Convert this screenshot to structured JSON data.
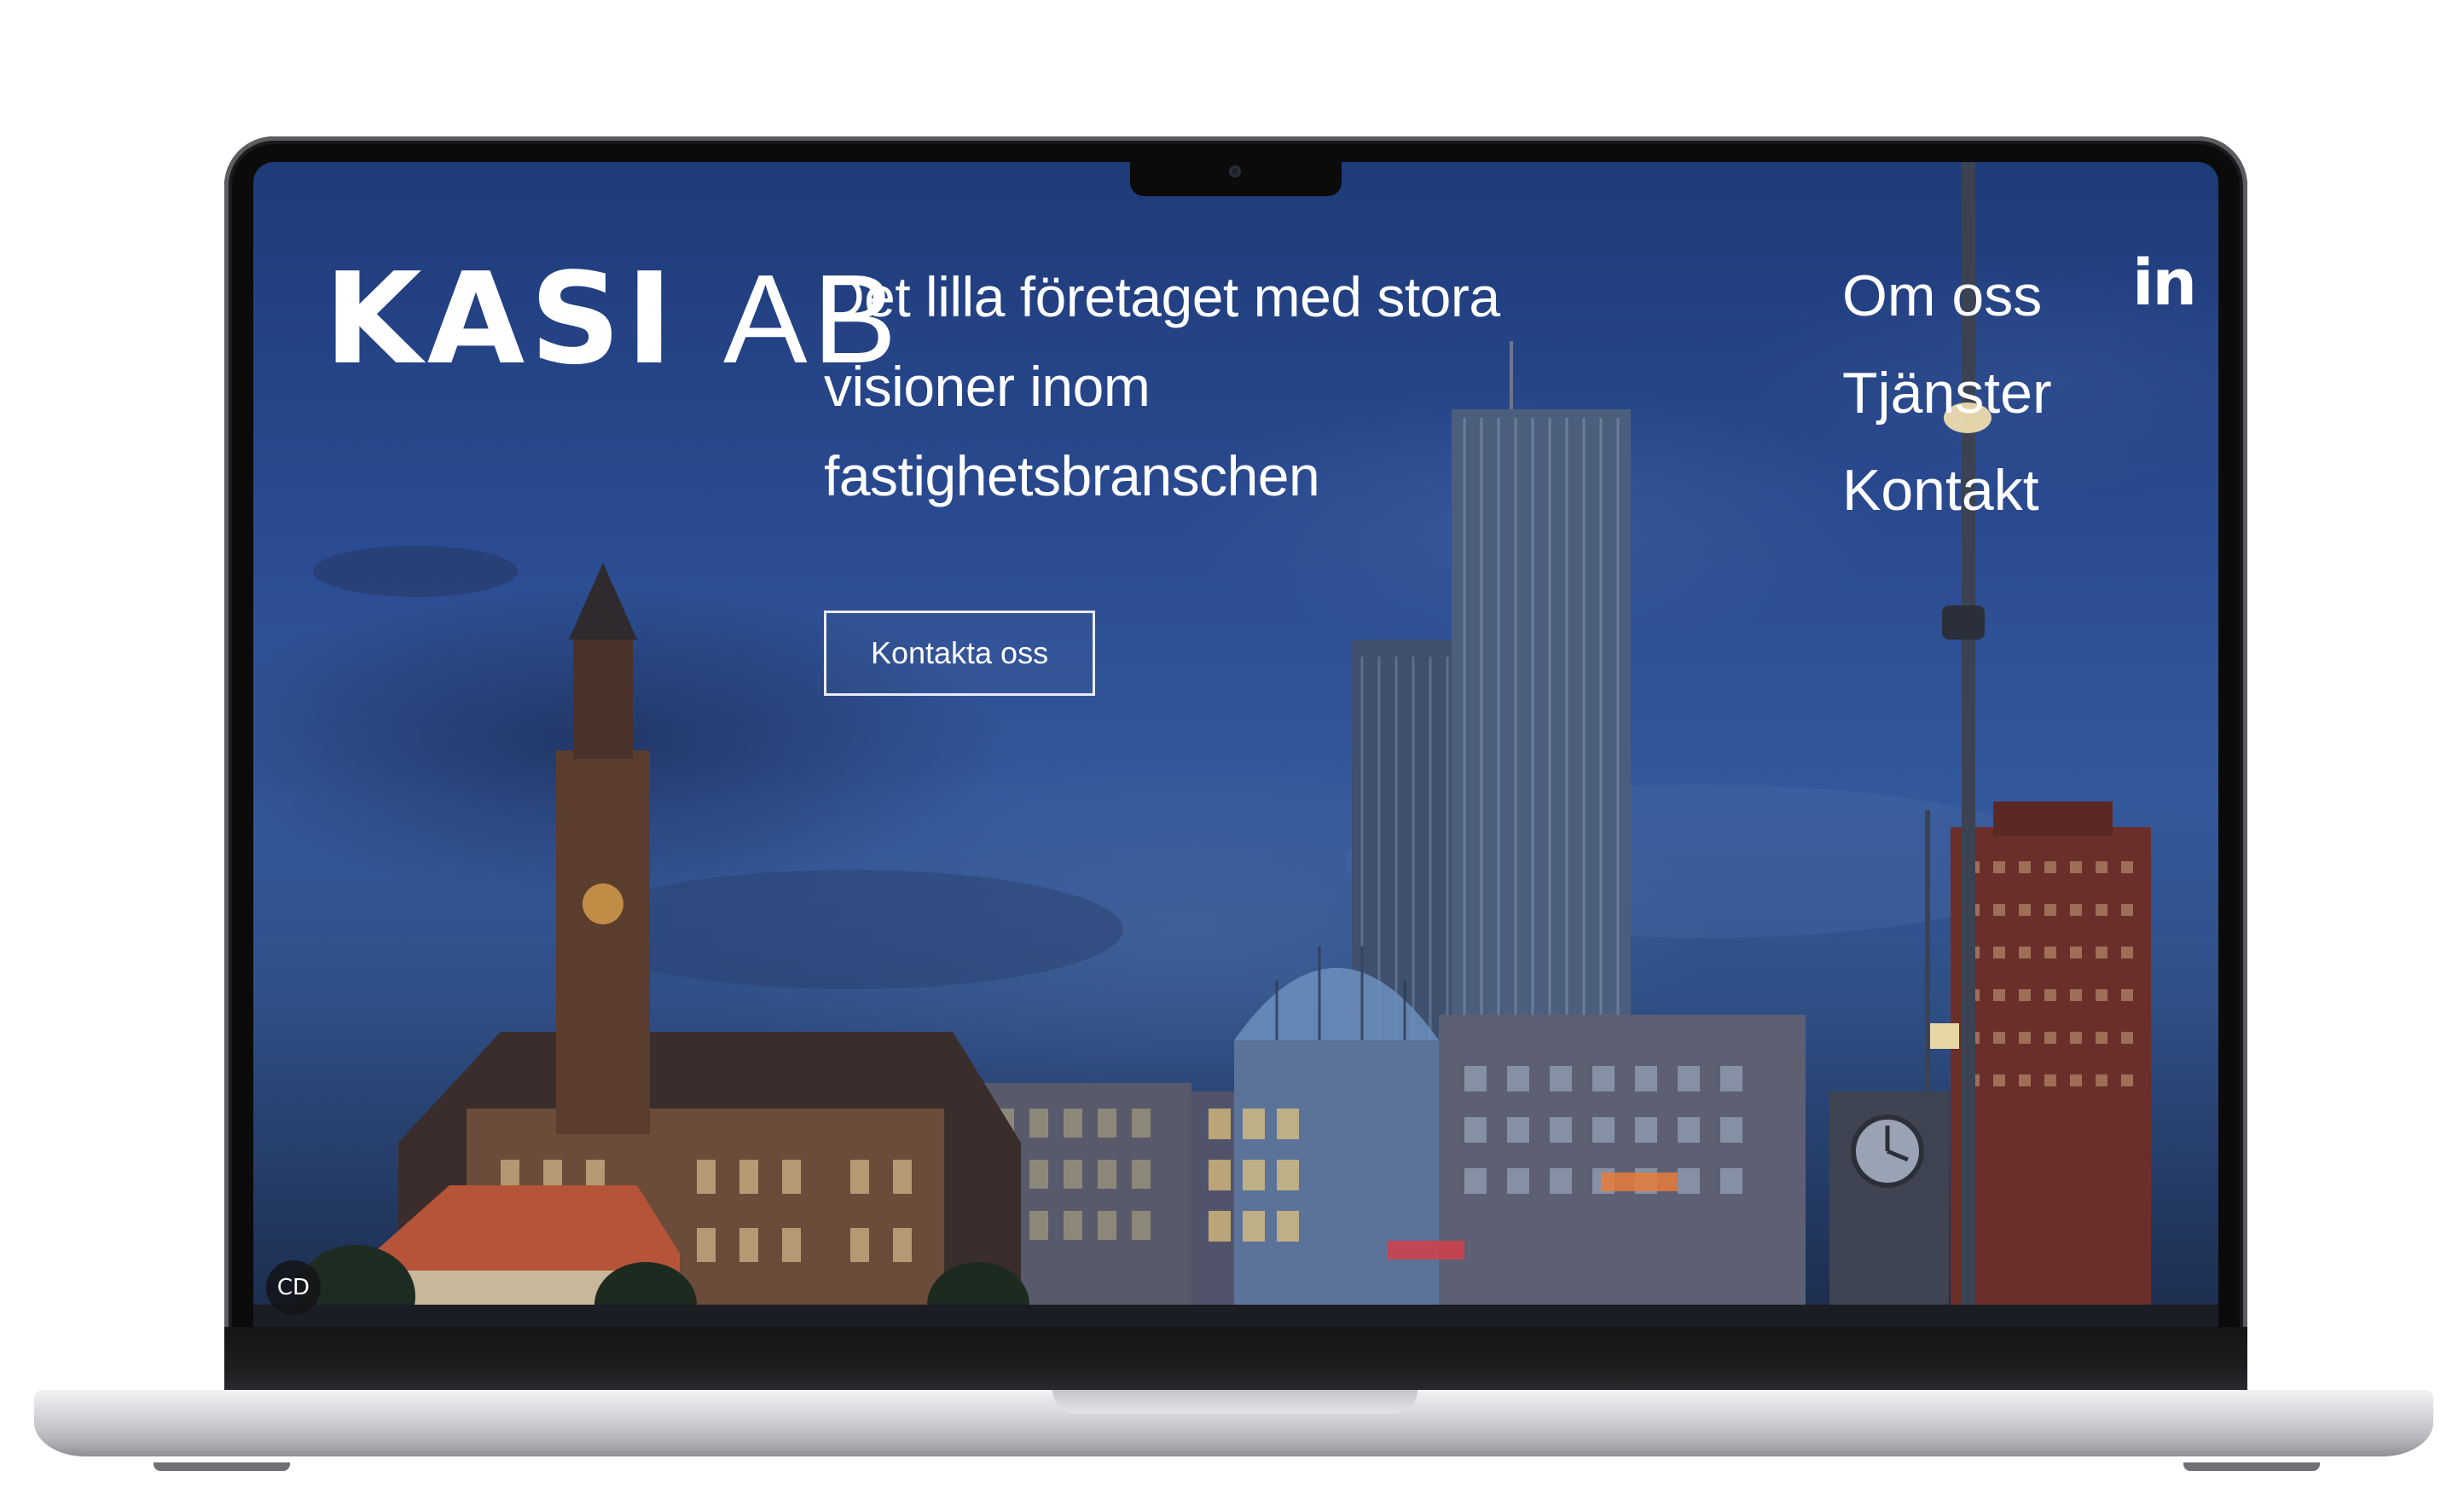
{
  "site": {
    "logo": {
      "part1": "KASI",
      "part2": "AB"
    },
    "tagline": "Det lilla företaget med stora visioner inom fastighetsbranschen",
    "cta_label": "Kontakta oss",
    "nav": [
      "Om oss",
      "Tjänster",
      "Kontakt"
    ],
    "social": {
      "linkedin_label": "in"
    },
    "badge_label": "CD"
  },
  "colors": {
    "sky": "#2a4a90",
    "text": "#ffffff",
    "bezel": "#0b0b0c",
    "aluminum": "#d6d8dc"
  },
  "icons": [
    "linkedin-icon",
    "camera-icon",
    "cc-badge-icon"
  ]
}
